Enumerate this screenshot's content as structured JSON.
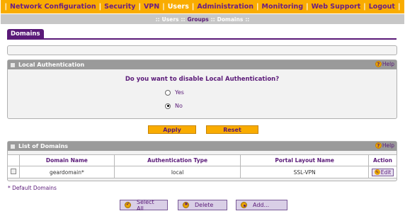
{
  "topnav": {
    "items": [
      "Network Configuration",
      "Security",
      "VPN",
      "Users",
      "Administration",
      "Monitoring",
      "Web Support",
      "Logout"
    ]
  },
  "subnav": {
    "items": [
      "Users",
      "Groups",
      "Domains"
    ]
  },
  "page": {
    "tab": "Domains"
  },
  "local_auth": {
    "title": "Local Authentication",
    "help": "Help",
    "question": "Do you want to disable Local Authentication?",
    "options": [
      "Yes",
      "No"
    ],
    "selected": "No"
  },
  "buttons": {
    "apply": "Apply",
    "reset": "Reset"
  },
  "domains": {
    "title": "List of Domains",
    "help": "Help",
    "columns": [
      "Domain Name",
      "Authentication Type",
      "Portal Layout Name",
      "Action"
    ],
    "rows": [
      {
        "domain": "geardomain*",
        "auth": "local",
        "portal": "SSL-VPN",
        "action": "Edit"
      }
    ],
    "footnote": "* Default Domains"
  },
  "bottom_buttons": {
    "select_all": "Select All",
    "delete": "Delete",
    "add": "Add..."
  },
  "colors": {
    "accent": "#f9ac00",
    "brand": "#5a1a78",
    "header_gray": "#9a9a9a"
  }
}
